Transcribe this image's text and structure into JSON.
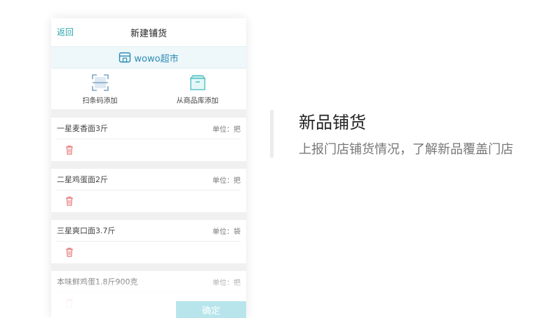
{
  "header": {
    "back_label": "返回",
    "title": "新建铺货"
  },
  "store": {
    "name": "wowo超市",
    "icon": "store-icon"
  },
  "actions": [
    {
      "label": "扫条码添加",
      "icon": "barcode-scan-icon"
    },
    {
      "label": "从商品库添加",
      "icon": "product-box-icon"
    }
  ],
  "items": [
    {
      "name": "一星麦香面3斤",
      "unit": "单位：把"
    },
    {
      "name": "二星鸡蛋面2斤",
      "unit": "单位：把"
    },
    {
      "name": "三星爽口面3.7斤",
      "unit": "单位：袋"
    },
    {
      "name": "本味鲜鸡蛋1.8斤900克",
      "unit": "单位：把"
    }
  ],
  "footer": {
    "confirm_label": "确定",
    "left_label": ""
  },
  "feature": {
    "title": "新品铺货",
    "description": "上报门店铺货情况，了解新品覆盖门店"
  },
  "colors": {
    "accent": "#2aa6ad",
    "store_text": "#2b8bb2",
    "trash": "#e88888",
    "confirm": "#9fdde5"
  }
}
